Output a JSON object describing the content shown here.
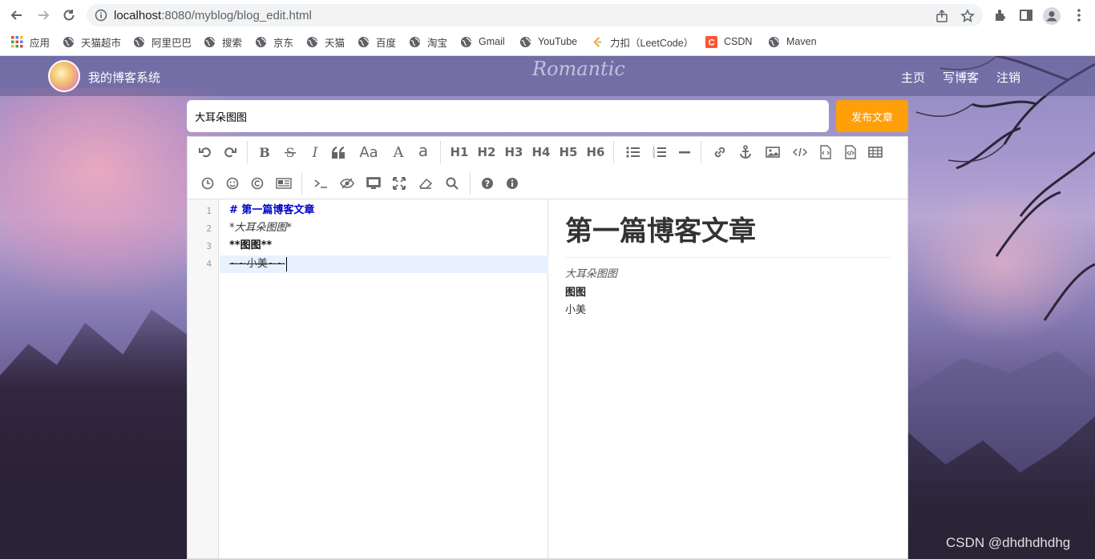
{
  "browser": {
    "url_host": "localhost",
    "url_rest": ":8080/myblog/blog_edit.html",
    "bookmarks": [
      {
        "label": "应用",
        "icon": "apps-grid-icon"
      },
      {
        "label": "天猫超市",
        "icon": "globe-icon"
      },
      {
        "label": "阿里巴巴",
        "icon": "globe-icon"
      },
      {
        "label": "搜索",
        "icon": "globe-icon"
      },
      {
        "label": "京东",
        "icon": "globe-icon"
      },
      {
        "label": "天猫",
        "icon": "globe-icon"
      },
      {
        "label": "百度",
        "icon": "globe-icon"
      },
      {
        "label": "淘宝",
        "icon": "globe-icon"
      },
      {
        "label": "Gmail",
        "icon": "globe-icon"
      },
      {
        "label": "YouTube",
        "icon": "globe-icon"
      },
      {
        "label": "力扣（LeetCode）",
        "icon": "leetcode-icon"
      },
      {
        "label": "CSDN",
        "icon": "csdn-icon"
      },
      {
        "label": "Maven",
        "icon": "globe-icon"
      }
    ]
  },
  "header": {
    "site_title": "我的博客系统",
    "banner_text": "Romantic",
    "nav": [
      "主页",
      "写博客",
      "注销"
    ]
  },
  "editor": {
    "title_value": "大耳朵图图",
    "publish_label": "发布文章",
    "toolbar_headings": [
      "H1",
      "H2",
      "H3",
      "H4",
      "H5",
      "H6"
    ],
    "toolbar_text_items": {
      "case": "Aa",
      "font_a": "A",
      "lower_a": "a"
    },
    "line_numbers": [
      "1",
      "2",
      "3",
      "4"
    ],
    "lines": [
      "#  第一篇博客文章",
      "*大耳朵图图*",
      "**图图**",
      "~~小美~~"
    ],
    "preview": {
      "h1": "第一篇博客文章",
      "em": "大耳朵图图",
      "strong": "图图",
      "del": "小美"
    }
  },
  "watermark": "CSDN @dhdhdhdhg",
  "colors": {
    "accent": "#ff9f0a",
    "heading_blue": "#0000cc",
    "active_line": "#e8f2ff"
  }
}
